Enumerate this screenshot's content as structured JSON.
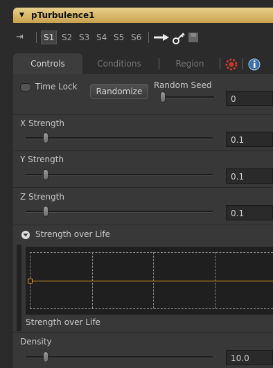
{
  "header": {
    "title": "pTurbulence1"
  },
  "toolbar": {
    "slots": [
      "S1",
      "S2",
      "S3",
      "S4",
      "S5",
      "S6"
    ],
    "selected_slot": "S1"
  },
  "tabs": [
    {
      "label": "Controls",
      "active": true
    },
    {
      "label": "Conditions",
      "active": false
    },
    {
      "label": "Region",
      "active": false
    }
  ],
  "controls": {
    "time_lock_label": "Time Lock",
    "randomize_label": "Randomize",
    "random_seed": {
      "label": "Random Seed",
      "value": "0"
    },
    "x_strength": {
      "label": "X Strength",
      "value": "0.1"
    },
    "y_strength": {
      "label": "Y Strength",
      "value": "0.1"
    },
    "z_strength": {
      "label": "Z Strength",
      "value": "0.1"
    },
    "strength_over_life": {
      "section_label": "Strength over Life",
      "graph_label": "Strength over Life"
    },
    "density": {
      "label": "Density",
      "value": "10.0"
    }
  },
  "colors": {
    "accent": "#e0a020",
    "header": "#d8b86a"
  }
}
